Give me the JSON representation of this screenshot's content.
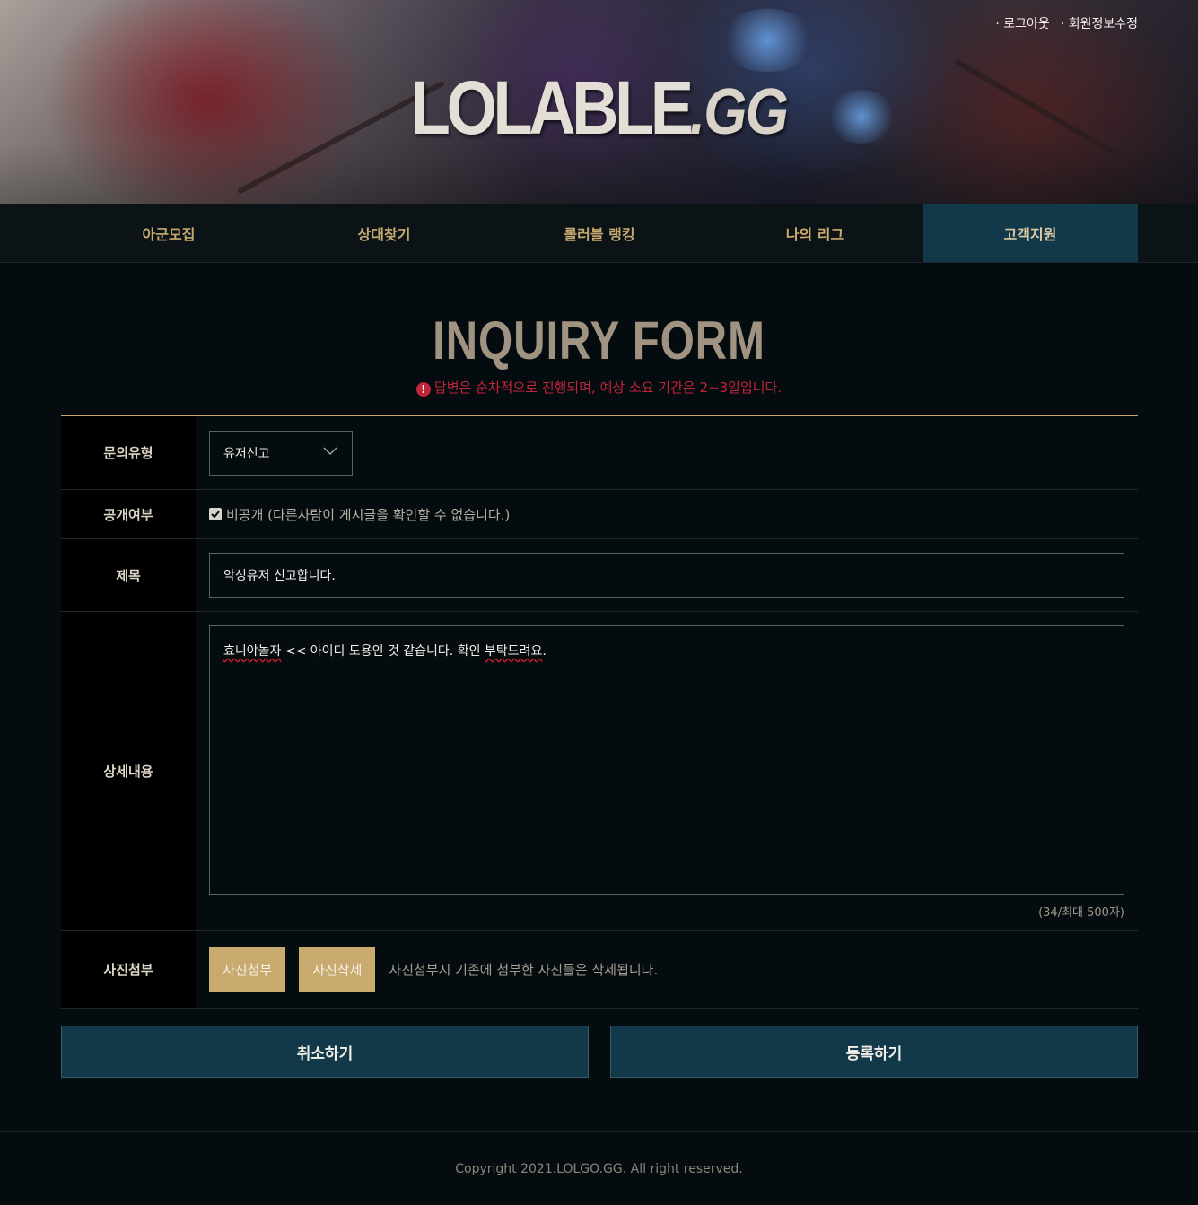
{
  "header": {
    "logo_main": "LOLABLE",
    "logo_suffix": ".GG",
    "top_links": [
      "로그아웃",
      "회원정보수정"
    ]
  },
  "nav": {
    "items": [
      "아군모집",
      "상대찾기",
      "롤러블 랭킹",
      "나의 리그",
      "고객지원"
    ],
    "active_index": 4
  },
  "page": {
    "title": "INQUIRY FORM",
    "notice": "답변은 순차적으로 진행되며, 예상 소요 기간은 2~3일입니다.",
    "notice_icon": "!"
  },
  "form": {
    "type": {
      "label": "문의유형",
      "value": "유저신고"
    },
    "public": {
      "label": "공개여부",
      "checked": true,
      "option_text": "비공개 (다른사람이 게시글을 확인할 수 없습니다.)"
    },
    "subject": {
      "label": "제목",
      "value": "악성유저 신고합니다."
    },
    "detail": {
      "label": "상세내용",
      "value_parts": [
        "효니야놀자",
        " << 아이디 도용인 것 같습니다. 확인 ",
        "부탁드려요",
        "."
      ],
      "counter": "(34/최대 500자)"
    },
    "photo": {
      "label": "사진첨부",
      "attach_label": "사진첨부",
      "delete_label": "사진삭제",
      "note": "사진첨부시 기존에 첨부한 사진들은 삭제됩니다."
    }
  },
  "actions": {
    "cancel_label": "취소하기",
    "submit_label": "등록하기"
  },
  "footer": {
    "copyright": "Copyright 2021.LOLGO.GG. All right reserved."
  },
  "colors": {
    "accent_gold": "#c8aa6e",
    "nav_active": "#12394a",
    "notice_red": "#c2243a",
    "background": "#050c10"
  }
}
